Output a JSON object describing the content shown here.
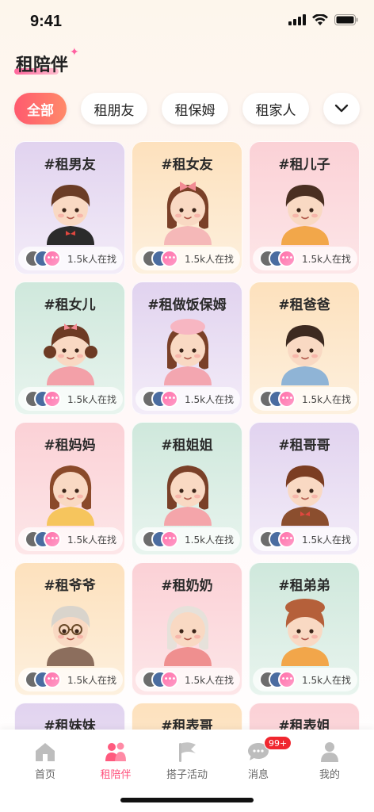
{
  "status": {
    "time": "9:41"
  },
  "header": {
    "title": "租陪伴"
  },
  "filters": [
    {
      "label": "全部",
      "active": true
    },
    {
      "label": "租朋友",
      "active": false
    },
    {
      "label": "租保姆",
      "active": false
    },
    {
      "label": "租家人",
      "active": false
    }
  ],
  "cards": [
    {
      "title": "#租男友",
      "count": "1.5k人在找",
      "bg": "purple",
      "avatar": "man-suit"
    },
    {
      "title": "#租女友",
      "count": "1.5k人在找",
      "bg": "orange",
      "avatar": "girl-bow"
    },
    {
      "title": "#租儿子",
      "count": "1.5k人在找",
      "bg": "pink",
      "avatar": "boy-overalls"
    },
    {
      "title": "#租女儿",
      "count": "1.5k人在找",
      "bg": "green",
      "avatar": "girl-pigtails"
    },
    {
      "title": "#租做饭保姆",
      "count": "1.5k人在找",
      "bg": "purple",
      "avatar": "nanny-cap"
    },
    {
      "title": "#租爸爸",
      "count": "1.5k人在找",
      "bg": "orange",
      "avatar": "dad"
    },
    {
      "title": "#租妈妈",
      "count": "1.5k人在找",
      "bg": "pink",
      "avatar": "mom"
    },
    {
      "title": "#租姐姐",
      "count": "1.5k人在找",
      "bg": "green",
      "avatar": "sister"
    },
    {
      "title": "#租哥哥",
      "count": "1.5k人在找",
      "bg": "purple",
      "avatar": "brother"
    },
    {
      "title": "#租爷爷",
      "count": "1.5k人在找",
      "bg": "orange",
      "avatar": "grandpa"
    },
    {
      "title": "#租奶奶",
      "count": "1.5k人在找",
      "bg": "pink",
      "avatar": "grandma"
    },
    {
      "title": "#租弟弟",
      "count": "1.5k人在找",
      "bg": "green",
      "avatar": "little-brother"
    },
    {
      "title": "#租妹妹",
      "count": "",
      "bg": "purple",
      "avatar": ""
    },
    {
      "title": "#租表哥",
      "count": "",
      "bg": "orange",
      "avatar": ""
    },
    {
      "title": "#租表姐",
      "count": "",
      "bg": "pink",
      "avatar": ""
    }
  ],
  "tabbar": {
    "items": [
      {
        "label": "首页",
        "icon": "home-icon",
        "active": false
      },
      {
        "label": "租陪伴",
        "icon": "companion-icon",
        "active": true
      },
      {
        "label": "搭子活动",
        "icon": "flag-icon",
        "active": false
      },
      {
        "label": "消息",
        "icon": "chat-icon",
        "active": false,
        "badge": "99+"
      },
      {
        "label": "我的",
        "icon": "profile-icon",
        "active": false
      }
    ]
  },
  "colors": {
    "accent": "#ff4f7b",
    "badge": "#f0272f"
  }
}
